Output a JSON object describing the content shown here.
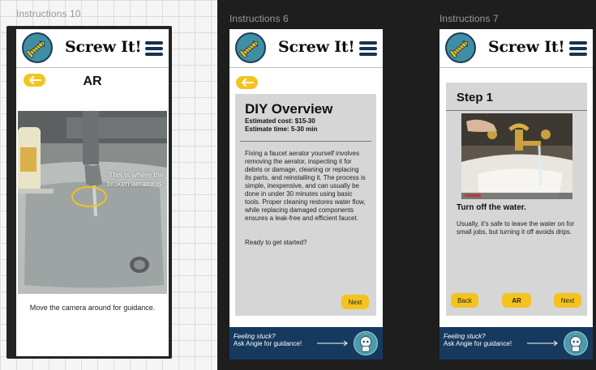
{
  "frames": {
    "instructions10": {
      "label": "Instructions 10",
      "app_title": "Screw It!",
      "page_title": "AR",
      "ar_hint": "This is where the broken aerator is.",
      "camera_caption": "Move the camera around for guidance."
    },
    "instructions6": {
      "label": "Instructions 6",
      "app_title": "Screw It!",
      "overview_title": "DIY Overview",
      "estimated_cost": "Estimated cost: $15-30",
      "estimated_time": "Estimate time: 5-30 min",
      "description": "Fixing a faucet aerator yourself involves removing the aerator, inspecting it for debris or damage, cleaning or replacing its parts, and reinstalling it. The process is simple, inexpensive, and can usually be done in under 30 minutes using basic tools. Proper cleaning restores water flow, while replacing damaged components ensures a leak-free and efficient faucet.",
      "ready_prompt": "Ready to get started?",
      "next_label": "Next",
      "help_line1": "Feeling stuck?",
      "help_line2": "Ask Angie for guidance!"
    },
    "instructions7": {
      "label": "Instructions 7",
      "app_title": "Screw It!",
      "step_title": "Step 1",
      "step_heading": "Turn off the water.",
      "step_body": "Usually, it's safe to leave the water on for small jobs, but turning it off avoids drips.",
      "back_label": "Back",
      "ar_label": "AR",
      "next_label": "Next",
      "help_line1": "Feeling stuck?",
      "help_line2": "Ask Angie for guidance!"
    }
  },
  "icons": {
    "logo": "screw-logo-icon",
    "menu": "hamburger-menu-icon",
    "back": "back-arrow-icon",
    "help_arrow": "arrow-right-icon",
    "assistant": "angie-robot-avatar-icon"
  },
  "colors": {
    "accent_yellow": "#f4c320",
    "navy": "#163a5f",
    "logo_teal": "#3f8fa4",
    "card_grey": "#d6d6d6",
    "ar_ring": "#f2c318"
  }
}
